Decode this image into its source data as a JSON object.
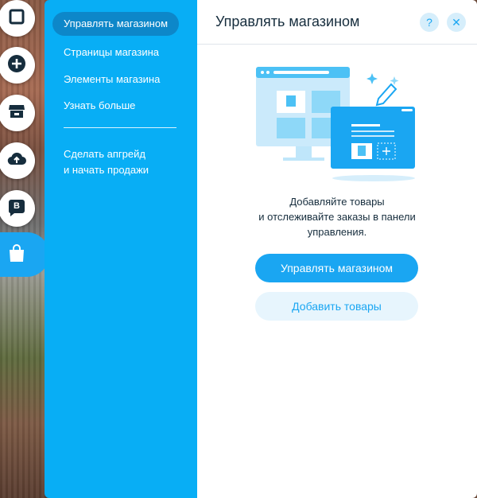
{
  "nav": {
    "items": [
      {
        "label": "Управлять магазином",
        "active": true
      },
      {
        "label": "Страницы магазина"
      },
      {
        "label": "Элементы магазина"
      },
      {
        "label": "Узнать больше"
      }
    ],
    "upgrade_line1": "Сделать апгрейд",
    "upgrade_line2": "и начать продажи"
  },
  "toolbar": {
    "icons": [
      "square-icon",
      "plus-icon",
      "store-icon",
      "upload-cloud-icon",
      "blog-icon",
      "shopping-bag-icon"
    ],
    "blog_letter": "B",
    "accent": "#1aa6f2"
  },
  "main": {
    "title": "Управлять магазином",
    "help_label": "?",
    "close_label": "✕",
    "desc_line1": "Добавляйте товары",
    "desc_line2": "и отслеживайте заказы в  панели",
    "desc_line3": "управления.",
    "primary_button": "Управлять магазином",
    "secondary_button": "Добавить товары"
  },
  "colors": {
    "nav_bg": "#08aef5",
    "nav_active": "#0d87c9",
    "primary": "#1aa6f2",
    "secondary_bg": "#e7f5fd",
    "text": "#162d3d"
  }
}
